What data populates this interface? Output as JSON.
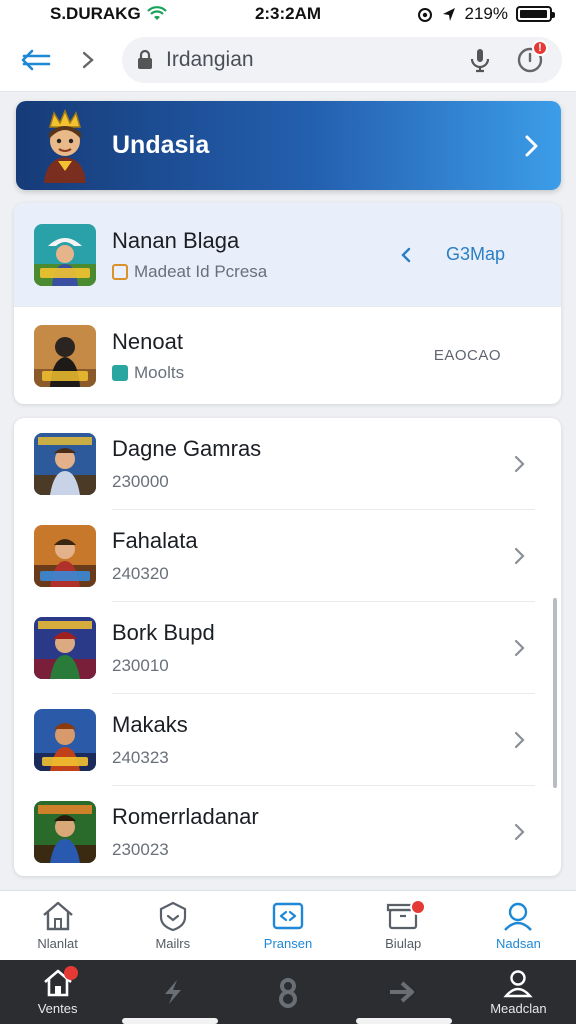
{
  "status_bar": {
    "carrier": "S.DURAKG",
    "time": "2:3:2AM",
    "battery_text": "219%",
    "battery_level": 0.95
  },
  "nav": {
    "back_icon": "back-arrow-icon",
    "forward_icon": "chevron-right-icon",
    "search_text": "Irdangian",
    "badge": "!"
  },
  "banner": {
    "title": "Undasia"
  },
  "featured": [
    {
      "title": "Nanan Blaga",
      "subtitle": "Madeat Id Pcresa",
      "action": "G3Map",
      "selected": true
    },
    {
      "title": "Nenoat",
      "subtitle": "Moolts",
      "code": "EAOCAO",
      "selected": false
    }
  ],
  "games": [
    {
      "title": "Dagne Gamras",
      "subtitle": "230000"
    },
    {
      "title": "Fahalata",
      "subtitle": "240320"
    },
    {
      "title": "Bork Bupd",
      "subtitle": "230010"
    },
    {
      "title": "Makaks",
      "subtitle": "240323"
    },
    {
      "title": "Romerrladanar",
      "subtitle": "230023"
    }
  ],
  "bottom_tabs": [
    {
      "label": "Nlanlat",
      "icon": "home-icon",
      "active": false
    },
    {
      "label": "Mailrs",
      "icon": "shield-icon",
      "active": false
    },
    {
      "label": "Pransen",
      "icon": "message-icon",
      "active": true
    },
    {
      "label": "Biulap",
      "icon": "box-icon",
      "active": false
    },
    {
      "label": "Nadsan",
      "icon": "profile-icon",
      "active": true
    }
  ],
  "system_nav": [
    {
      "label": "Ventes",
      "icon": "home-icon"
    },
    {
      "label": "",
      "icon": "bolt-icon"
    },
    {
      "label": "",
      "icon": "eight-icon"
    },
    {
      "label": "",
      "icon": "arrow-right-icon"
    },
    {
      "label": "Meadclan",
      "icon": "profile-icon"
    }
  ],
  "colors": {
    "accent": "#1e88d6",
    "banner_start": "#163b78",
    "banner_end": "#3c9de8",
    "badge": "#e53935"
  }
}
